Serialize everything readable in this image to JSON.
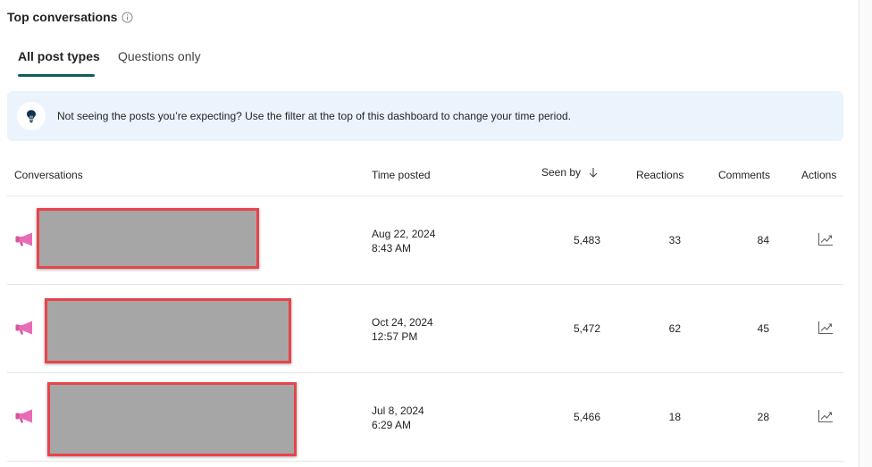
{
  "section": {
    "title": "Top conversations",
    "info_icon": "info-icon"
  },
  "tabs": [
    {
      "label": "All post types",
      "active": true
    },
    {
      "label": "Questions only",
      "active": false
    }
  ],
  "banner": {
    "icon": "lightbulb-icon",
    "text": "Not seeing the posts you’re expecting? Use the filter at the top of this dashboard to change your time period."
  },
  "table": {
    "columns": {
      "conversations": "Conversations",
      "time_posted": "Time posted",
      "seen_by": "Seen by",
      "reactions": "Reactions",
      "comments": "Comments",
      "actions": "Actions"
    },
    "sort_icon": "arrow-down-icon",
    "rows": [
      {
        "date": "Aug 22, 2024",
        "time": "8:43 AM",
        "seen_by": "5,483",
        "reactions": "33",
        "comments": "84",
        "post_icon": "megaphone-icon",
        "action_icon": "trend-chart-icon"
      },
      {
        "date": "Oct 24, 2024",
        "time": "12:57 PM",
        "seen_by": "5,472",
        "reactions": "62",
        "comments": "45",
        "post_icon": "megaphone-icon",
        "action_icon": "trend-chart-icon"
      },
      {
        "date": "Jul 8, 2024",
        "time": "6:29 AM",
        "seen_by": "5,466",
        "reactions": "18",
        "comments": "28",
        "post_icon": "megaphone-icon",
        "action_icon": "trend-chart-icon"
      }
    ]
  },
  "colors": {
    "tab_underline": "#0f5e57",
    "banner_bg": "#ebf3fc",
    "megaphone": "#e86bb5",
    "redaction_border": "#e8444c",
    "redaction_fill": "#a6a6a6"
  }
}
